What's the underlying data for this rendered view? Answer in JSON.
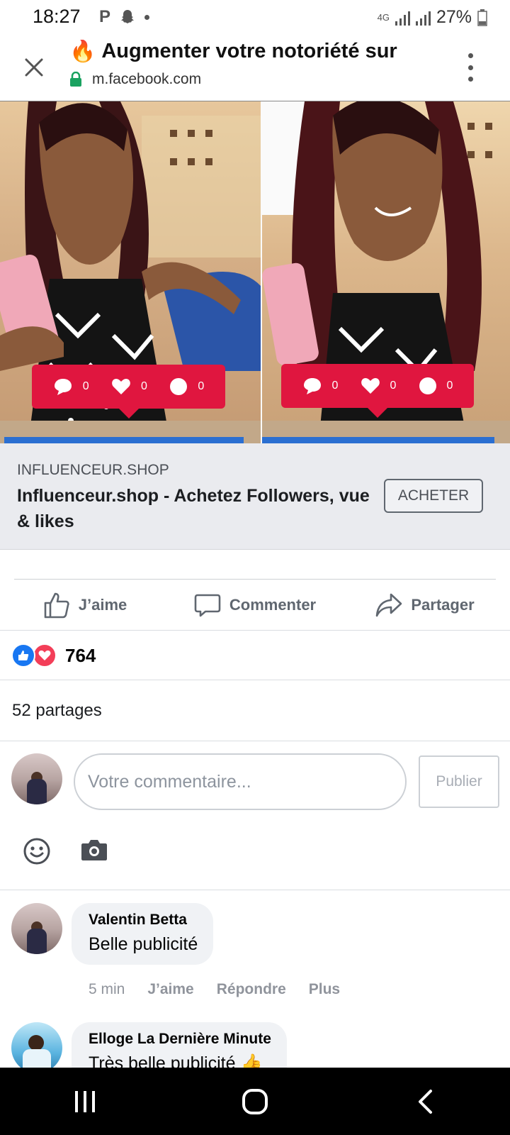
{
  "status_bar": {
    "time": "18:27",
    "network": "4G",
    "battery": "27%"
  },
  "browser": {
    "title": "Augmenter votre notoriété sur",
    "url": "m.facebook.com"
  },
  "ad": {
    "reaction_counts": [
      "0",
      "0",
      "0"
    ],
    "domain": "INFLUENCEUR.SHOP",
    "headline": "Influenceur.shop - Achetez Followers, vue & likes",
    "cta": "ACHETER"
  },
  "actions": {
    "like": "J’aime",
    "comment": "Commenter",
    "share": "Partager"
  },
  "reactions": {
    "count": "764"
  },
  "shares": {
    "text": "52 partages"
  },
  "composer": {
    "placeholder": "Votre commentaire...",
    "publish": "Publier"
  },
  "comments": [
    {
      "author": "Valentin Betta",
      "text": "Belle publicité",
      "time": "5 min",
      "like": "J’aime",
      "reply": "Répondre",
      "more": "Plus"
    },
    {
      "author": "Elloge La Dernière Minute",
      "text": "Très belle publicité 👍"
    }
  ],
  "colors": {
    "facebook_blue": "#1877f2",
    "love_red": "#f33e58",
    "reaction_bubble": "#e0163f",
    "secure_lock": "#1aa260"
  }
}
